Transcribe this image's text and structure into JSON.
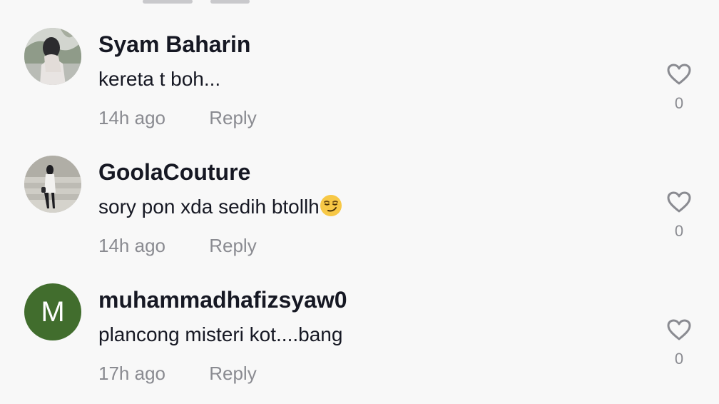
{
  "comments": [
    {
      "username": "Syam Baharin",
      "text": "kereta t boh...",
      "time": "14h ago",
      "reply_label": "Reply",
      "likes": "0",
      "avatar": "photo",
      "icons": {
        "like": "heart-outline-icon"
      }
    },
    {
      "username": "GoolaCouture",
      "text": "sory pon xda sedih btollh",
      "emoji": "smirking-face-emoji",
      "time": "14h ago",
      "reply_label": "Reply",
      "likes": "0",
      "avatar": "photo",
      "icons": {
        "like": "heart-outline-icon"
      }
    },
    {
      "username": "muhammadhafizsyaw0",
      "text": "plancong misteri kot....bang",
      "time": "17h ago",
      "reply_label": "Reply",
      "likes": "0",
      "avatar": "letter",
      "avatar_letter": "M",
      "avatar_color": "#416d2d",
      "icons": {
        "like": "heart-outline-icon"
      }
    }
  ],
  "colors": {
    "background": "#f8f8f8",
    "primary_text": "#161823",
    "secondary_text": "#8a8b91"
  }
}
